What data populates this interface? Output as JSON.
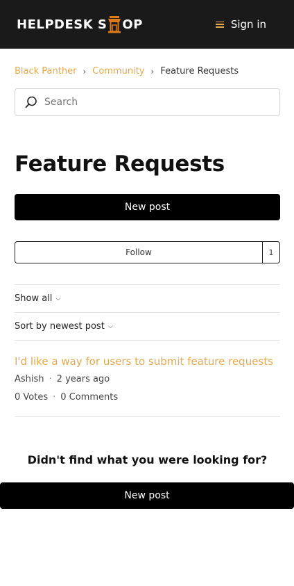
{
  "header": {
    "logo_left": "HELPDESK S",
    "logo_right": "OP",
    "menu_icon": "hamburger-icon",
    "sign_in": "Sign in"
  },
  "breadcrumb": [
    {
      "label": "Black Panther"
    },
    {
      "label": "Community"
    },
    {
      "label": "Feature Requests"
    }
  ],
  "search": {
    "placeholder": "Search",
    "icon": "search-icon"
  },
  "page": {
    "title": "Feature Requests"
  },
  "actions": {
    "new_post": "New post",
    "follow": "Follow",
    "follow_count": "1"
  },
  "filters": {
    "show": "Show all",
    "sort": "Sort by newest post"
  },
  "posts": [
    {
      "title": "I'd like a way for users to submit feature requests",
      "author": "Ashish",
      "time": "2 years ago",
      "votes": "0 Votes",
      "comments": "0 Comments"
    }
  ],
  "footer": {
    "not_found": "Didn't find what you were looking for?",
    "new_post": "New post"
  },
  "colors": {
    "accent": "#e9a84a",
    "header_bg": "#1a1a1a",
    "button_bg": "#000000"
  }
}
